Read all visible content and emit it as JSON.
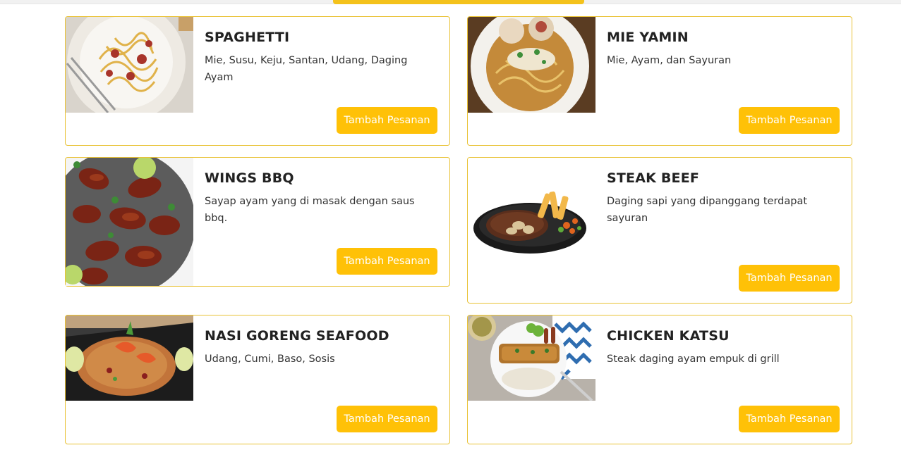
{
  "menu": {
    "button_label": "Tambah Pesanan",
    "items": [
      {
        "title": "SPAGHETTI",
        "description": "Mie, Susu, Keju, Santan, Udang, Daging Ayam",
        "image_icon": "spaghetti-photo"
      },
      {
        "title": "MIE YAMIN",
        "description": "Mie, Ayam, dan Sayuran",
        "image_icon": "mie-yamin-photo"
      },
      {
        "title": "WINGS BBQ",
        "description": "Sayap ayam yang di masak dengan saus bbq.",
        "image_icon": "wings-bbq-photo"
      },
      {
        "title": "STEAK BEEF",
        "description": "Daging sapi yang dipanggang terdapat sayuran",
        "image_icon": "steak-beef-photo"
      },
      {
        "title": "NASI GORENG SEAFOOD",
        "description": "Udang, Cumi, Baso, Sosis",
        "image_icon": "nasi-goreng-photo"
      },
      {
        "title": "CHICKEN KATSU",
        "description": "Steak daging ayam empuk di grill",
        "image_icon": "chicken-katsu-photo"
      }
    ]
  },
  "colors": {
    "accent": "#ffc107",
    "card_border": "#e9c235"
  }
}
